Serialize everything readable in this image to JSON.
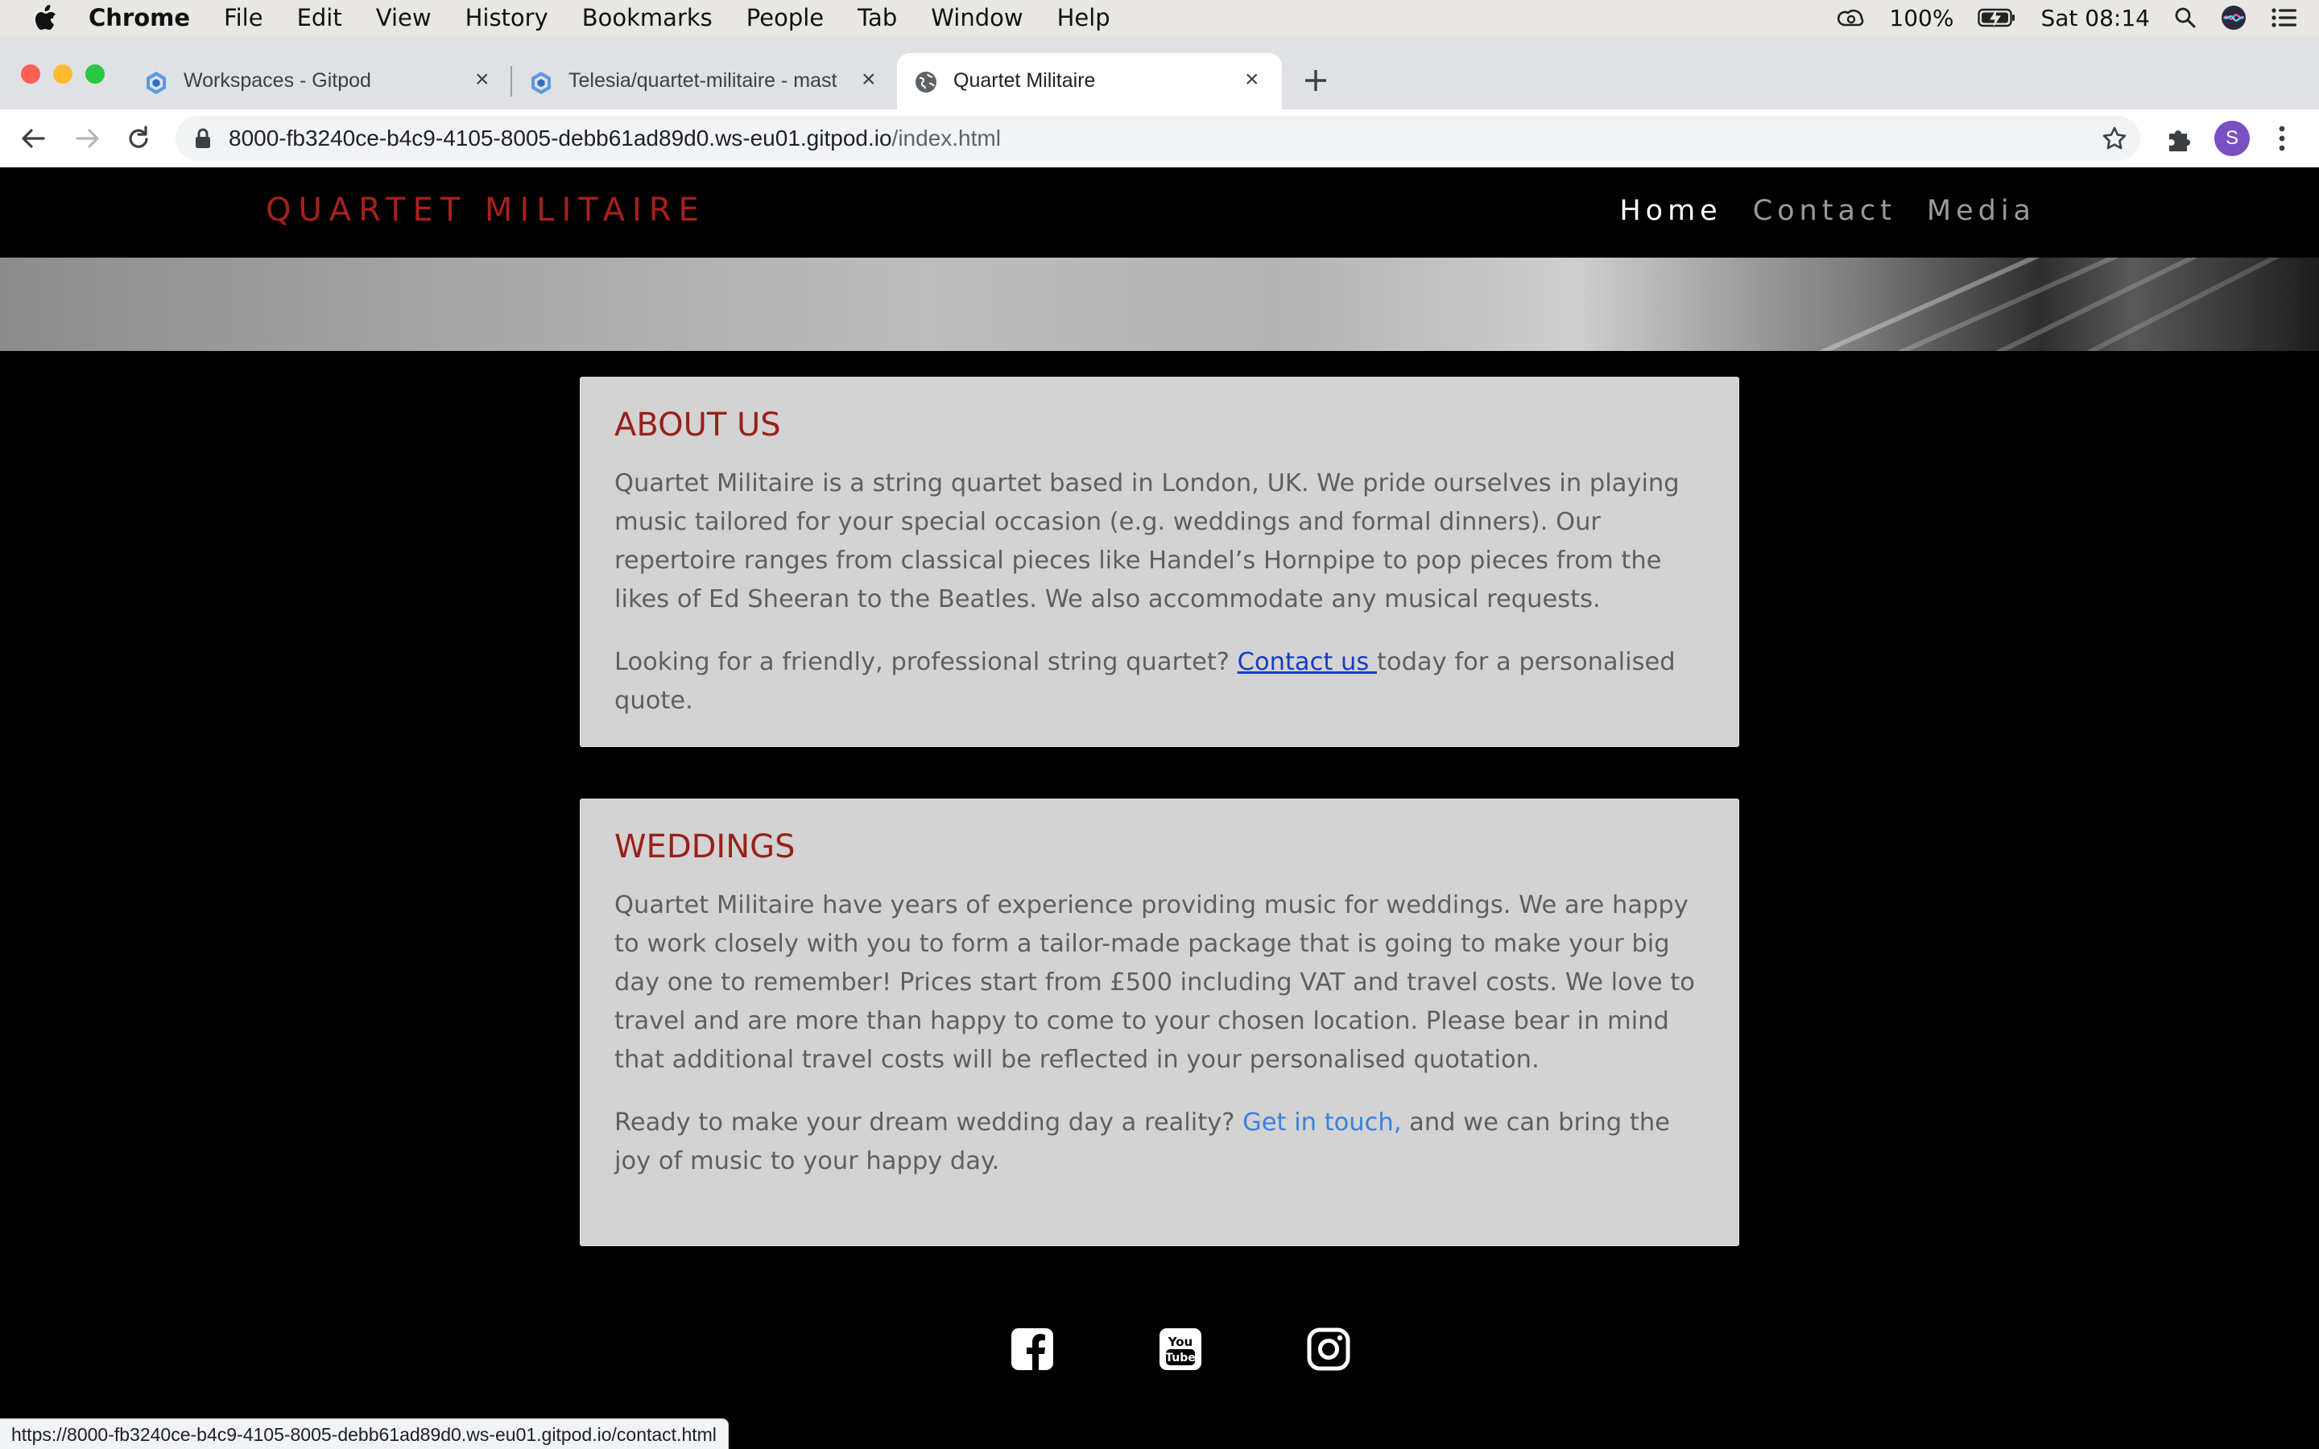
{
  "menubar": {
    "app": "Chrome",
    "items": [
      "File",
      "Edit",
      "View",
      "History",
      "Bookmarks",
      "People",
      "Tab",
      "Window",
      "Help"
    ],
    "battery": "100%",
    "clock": "Sat 08:14"
  },
  "tabs": [
    {
      "title": "Workspaces - Gitpod",
      "icon": "gitpod-icon"
    },
    {
      "title": "Telesia/quartet-militaire - mast",
      "icon": "gitpod-icon"
    },
    {
      "title": "Quartet Militaire",
      "icon": "globe-icon"
    }
  ],
  "address_bar": {
    "host": "8000-fb3240ce-b4c9-4105-8005-debb61ad89d0.ws-eu01.gitpod.io",
    "path": "/index.html"
  },
  "profile_initial": "S",
  "site": {
    "brand": "QUARTET MILITAIRE",
    "nav": [
      "Home",
      "Contact",
      "Media"
    ]
  },
  "about": {
    "heading": "ABOUT US",
    "body": "Quartet Militaire is a string quartet based in London, UK. We pride ourselves in playing music tailored for your special occasion (e.g. weddings and formal dinners). Our repertoire ranges from classical pieces like Handel’s Hornpipe to pop pieces from the likes of Ed Sheeran to the Beatles. We also accommodate any musical requests.",
    "cta_before": "Looking for a friendly, professional string quartet? ",
    "cta_link": "Contact us ",
    "cta_after": "today for a personalised quote."
  },
  "weddings": {
    "heading": "WEDDINGS",
    "body": "Quartet Militaire have years of experience providing music for weddings. We are happy to work closely with you to form a tailor-made package that is going to make your big day one to remember! Prices start from £500 including VAT and travel costs. We love to travel and are more than happy to come to your chosen location. Please bear in mind that additional travel costs will be reflected in your personalised quotation.",
    "cta_before": "Ready to make your dream wedding day a reality? ",
    "cta_link": "Get in touch,",
    "cta_after": " and we can bring the joy of music to your happy day."
  },
  "social": [
    "facebook-icon",
    "youtube-icon",
    "instagram-icon"
  ],
  "status_url": "https://8000-fb3240ce-b4c9-4105-8005-debb61ad89d0.ws-eu01.gitpod.io/contact.html",
  "colors": {
    "brand_red": "#a81f1c",
    "heading_red": "#9b1f1a",
    "card_bg": "#d3d3d3",
    "page_bg": "#000000",
    "link_blue": "#3b7fe0"
  }
}
